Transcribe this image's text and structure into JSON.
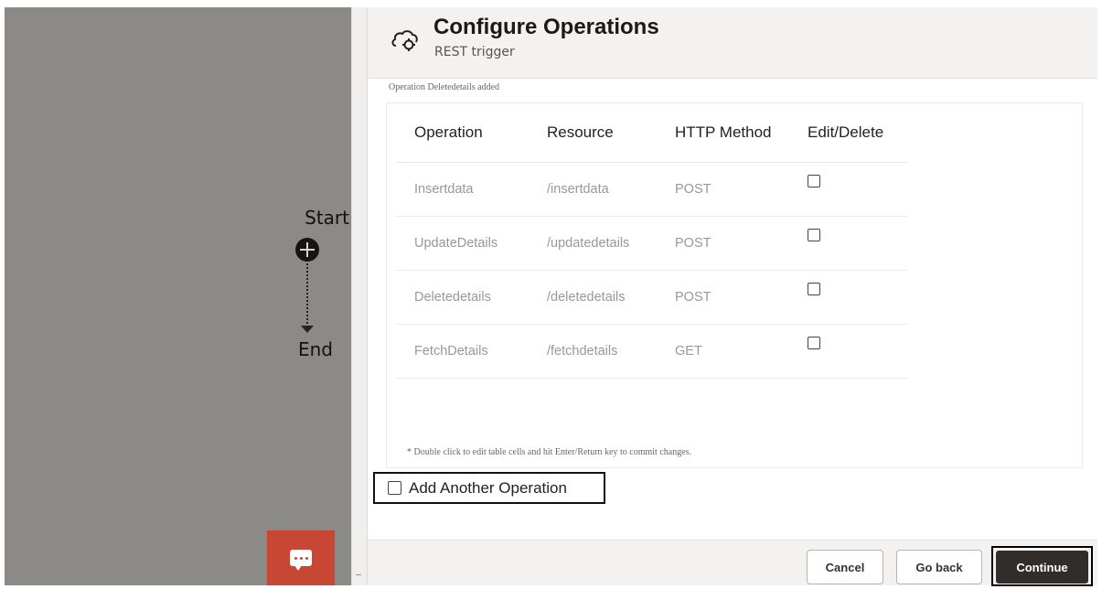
{
  "canvas": {
    "start_label": "Start",
    "end_label": "End"
  },
  "panel": {
    "title": "Configure Operations",
    "subtitle": "REST trigger",
    "status_message": "Operation Deletedetails added",
    "table": {
      "headers": [
        "Operation",
        "Resource",
        "HTTP Method",
        "Edit/Delete"
      ],
      "rows": [
        {
          "operation": "Insertdata",
          "resource": "/insertdata",
          "method": "POST",
          "checked": false
        },
        {
          "operation": "UpdateDetails",
          "resource": "/updatedetails",
          "method": "POST",
          "checked": false
        },
        {
          "operation": "Deletedetails",
          "resource": "/deletedetails",
          "method": "POST",
          "checked": false
        },
        {
          "operation": "FetchDetails",
          "resource": "/fetchdetails",
          "method": "GET",
          "checked": false
        }
      ],
      "note": "* Double click to edit table cells and hit Enter/Return key to commit changes."
    },
    "add_another": {
      "label": "Add Another Operation",
      "checked": false
    },
    "footer": {
      "cancel_label": "Cancel",
      "back_label": "Go back",
      "continue_label": "Continue"
    }
  },
  "icons": {
    "header": "rest-trigger-icon",
    "chat": "chat-icon",
    "add_node": "add-node-icon"
  },
  "colors": {
    "canvas": "#8c8a87",
    "chat_button": "#c74634",
    "continue_button": "#312d2a",
    "header_background": "#f3f2f0"
  }
}
